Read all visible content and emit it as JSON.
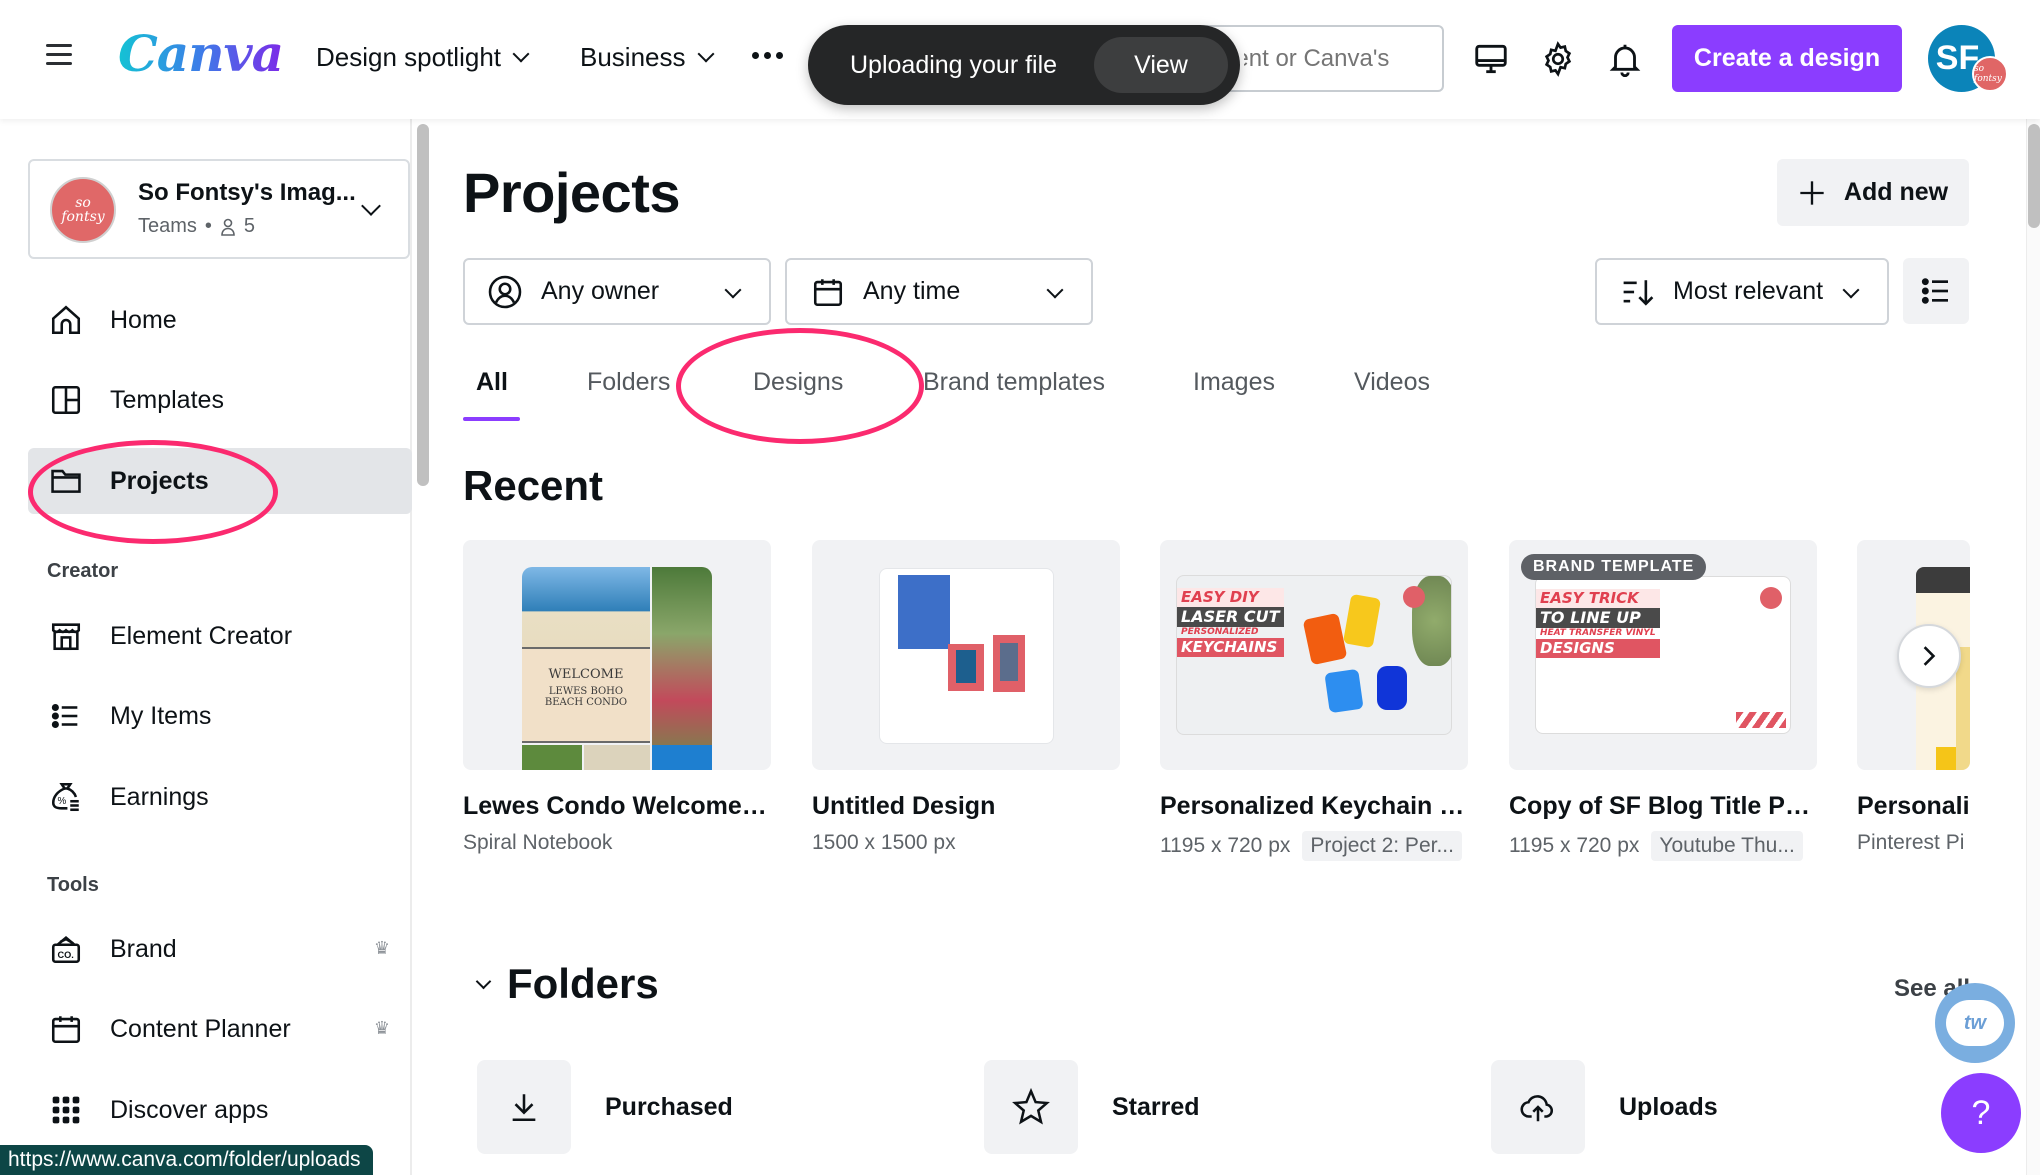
{
  "topbar": {
    "logo": "Canva",
    "nav": [
      {
        "label": "Design spotlight",
        "has_dropdown": true
      },
      {
        "label": "Business",
        "has_dropdown": true
      }
    ],
    "more_icon": "more-horizontal-icon",
    "search_placeholder": "Search your content or Canva's",
    "toast": {
      "message": "Uploading your file",
      "action": "View"
    },
    "icons": [
      "desktop-app-icon",
      "settings-gear-icon",
      "notification-bell-icon"
    ],
    "create_button": "Create a design",
    "avatar_initials": "SF",
    "avatar_badge_text": "so fontsy"
  },
  "sidebar": {
    "team": {
      "name": "So Fontsy's Imag...",
      "type": "Teams",
      "separator": "•",
      "members": "5",
      "logo_text": "so fontsy"
    },
    "items": [
      {
        "label": "Home",
        "icon": "home-icon",
        "active": false
      },
      {
        "label": "Templates",
        "icon": "templates-icon",
        "active": false
      },
      {
        "label": "Projects",
        "icon": "folder-icon",
        "active": true
      }
    ],
    "sections": [
      {
        "heading": "Creator",
        "items": [
          {
            "label": "Element Creator",
            "icon": "storefront-icon"
          },
          {
            "label": "My Items",
            "icon": "list-icon"
          },
          {
            "label": "Earnings",
            "icon": "money-bag-icon"
          }
        ]
      },
      {
        "heading": "Tools",
        "items": [
          {
            "label": "Brand",
            "icon": "brand-kit-icon",
            "premium": true
          },
          {
            "label": "Content Planner",
            "icon": "calendar-icon",
            "premium": true
          },
          {
            "label": "Discover apps",
            "icon": "apps-grid-icon",
            "premium": false
          }
        ]
      }
    ],
    "premium_icon": "♛"
  },
  "status_url": "https://www.canva.com/folder/uploads",
  "main": {
    "title": "Projects",
    "add_new": "Add new",
    "filters": {
      "owner": "Any owner",
      "time": "Any time",
      "sort": "Most relevant"
    },
    "tabs": [
      {
        "label": "All",
        "active": true
      },
      {
        "label": "Folders",
        "active": false
      },
      {
        "label": "Designs",
        "active": false
      },
      {
        "label": "Brand templates",
        "active": false
      },
      {
        "label": "Images",
        "active": false
      },
      {
        "label": "Videos",
        "active": false
      }
    ],
    "recent_heading": "Recent",
    "recent": [
      {
        "title": "Lewes Condo Welcome B...",
        "meta": "Spiral Notebook",
        "tag": null,
        "badge": null,
        "thumb": {
          "headline": "WELCOME",
          "sub": "LEWES BOHO BEACH CONDO"
        }
      },
      {
        "title": "Untitled Design",
        "meta": "1500 x 1500 px",
        "tag": null,
        "badge": null
      },
      {
        "title": "Personalized Keychain Ke...",
        "meta": "1195 x 720 px",
        "tag": "Project 2: Per...",
        "badge": null,
        "thumb": {
          "lines": [
            "EASY DIY",
            "LASER CUT",
            "PERSONALIZED",
            "KEYCHAINS"
          ]
        }
      },
      {
        "title": "Copy of SF Blog Title Pho...",
        "meta": "1195 x 720 px",
        "tag": "Youtube Thu...",
        "badge": "BRAND TEMPLATE",
        "thumb": {
          "lines": [
            "EASY TRICK",
            "TO LINE UP",
            "HEAT TRANSFER VINYL",
            "DESIGNS"
          ]
        }
      },
      {
        "title": "Personaliz",
        "meta": "Pinterest Pi",
        "tag": null,
        "badge": null
      }
    ],
    "folders_heading": "Folders",
    "see_all": "See all",
    "folders": [
      {
        "label": "Purchased",
        "icon": "download-icon"
      },
      {
        "label": "Starred",
        "icon": "star-icon"
      },
      {
        "label": "Uploads",
        "icon": "cloud-upload-icon"
      }
    ]
  },
  "floating": {
    "tw_label": "tw",
    "help_label": "?"
  },
  "colors": {
    "brand_purple": "#8b3dff",
    "annotation_pink": "#fb2a6f",
    "avatar_blue": "#0b84b9",
    "toast_bg": "#252627"
  }
}
